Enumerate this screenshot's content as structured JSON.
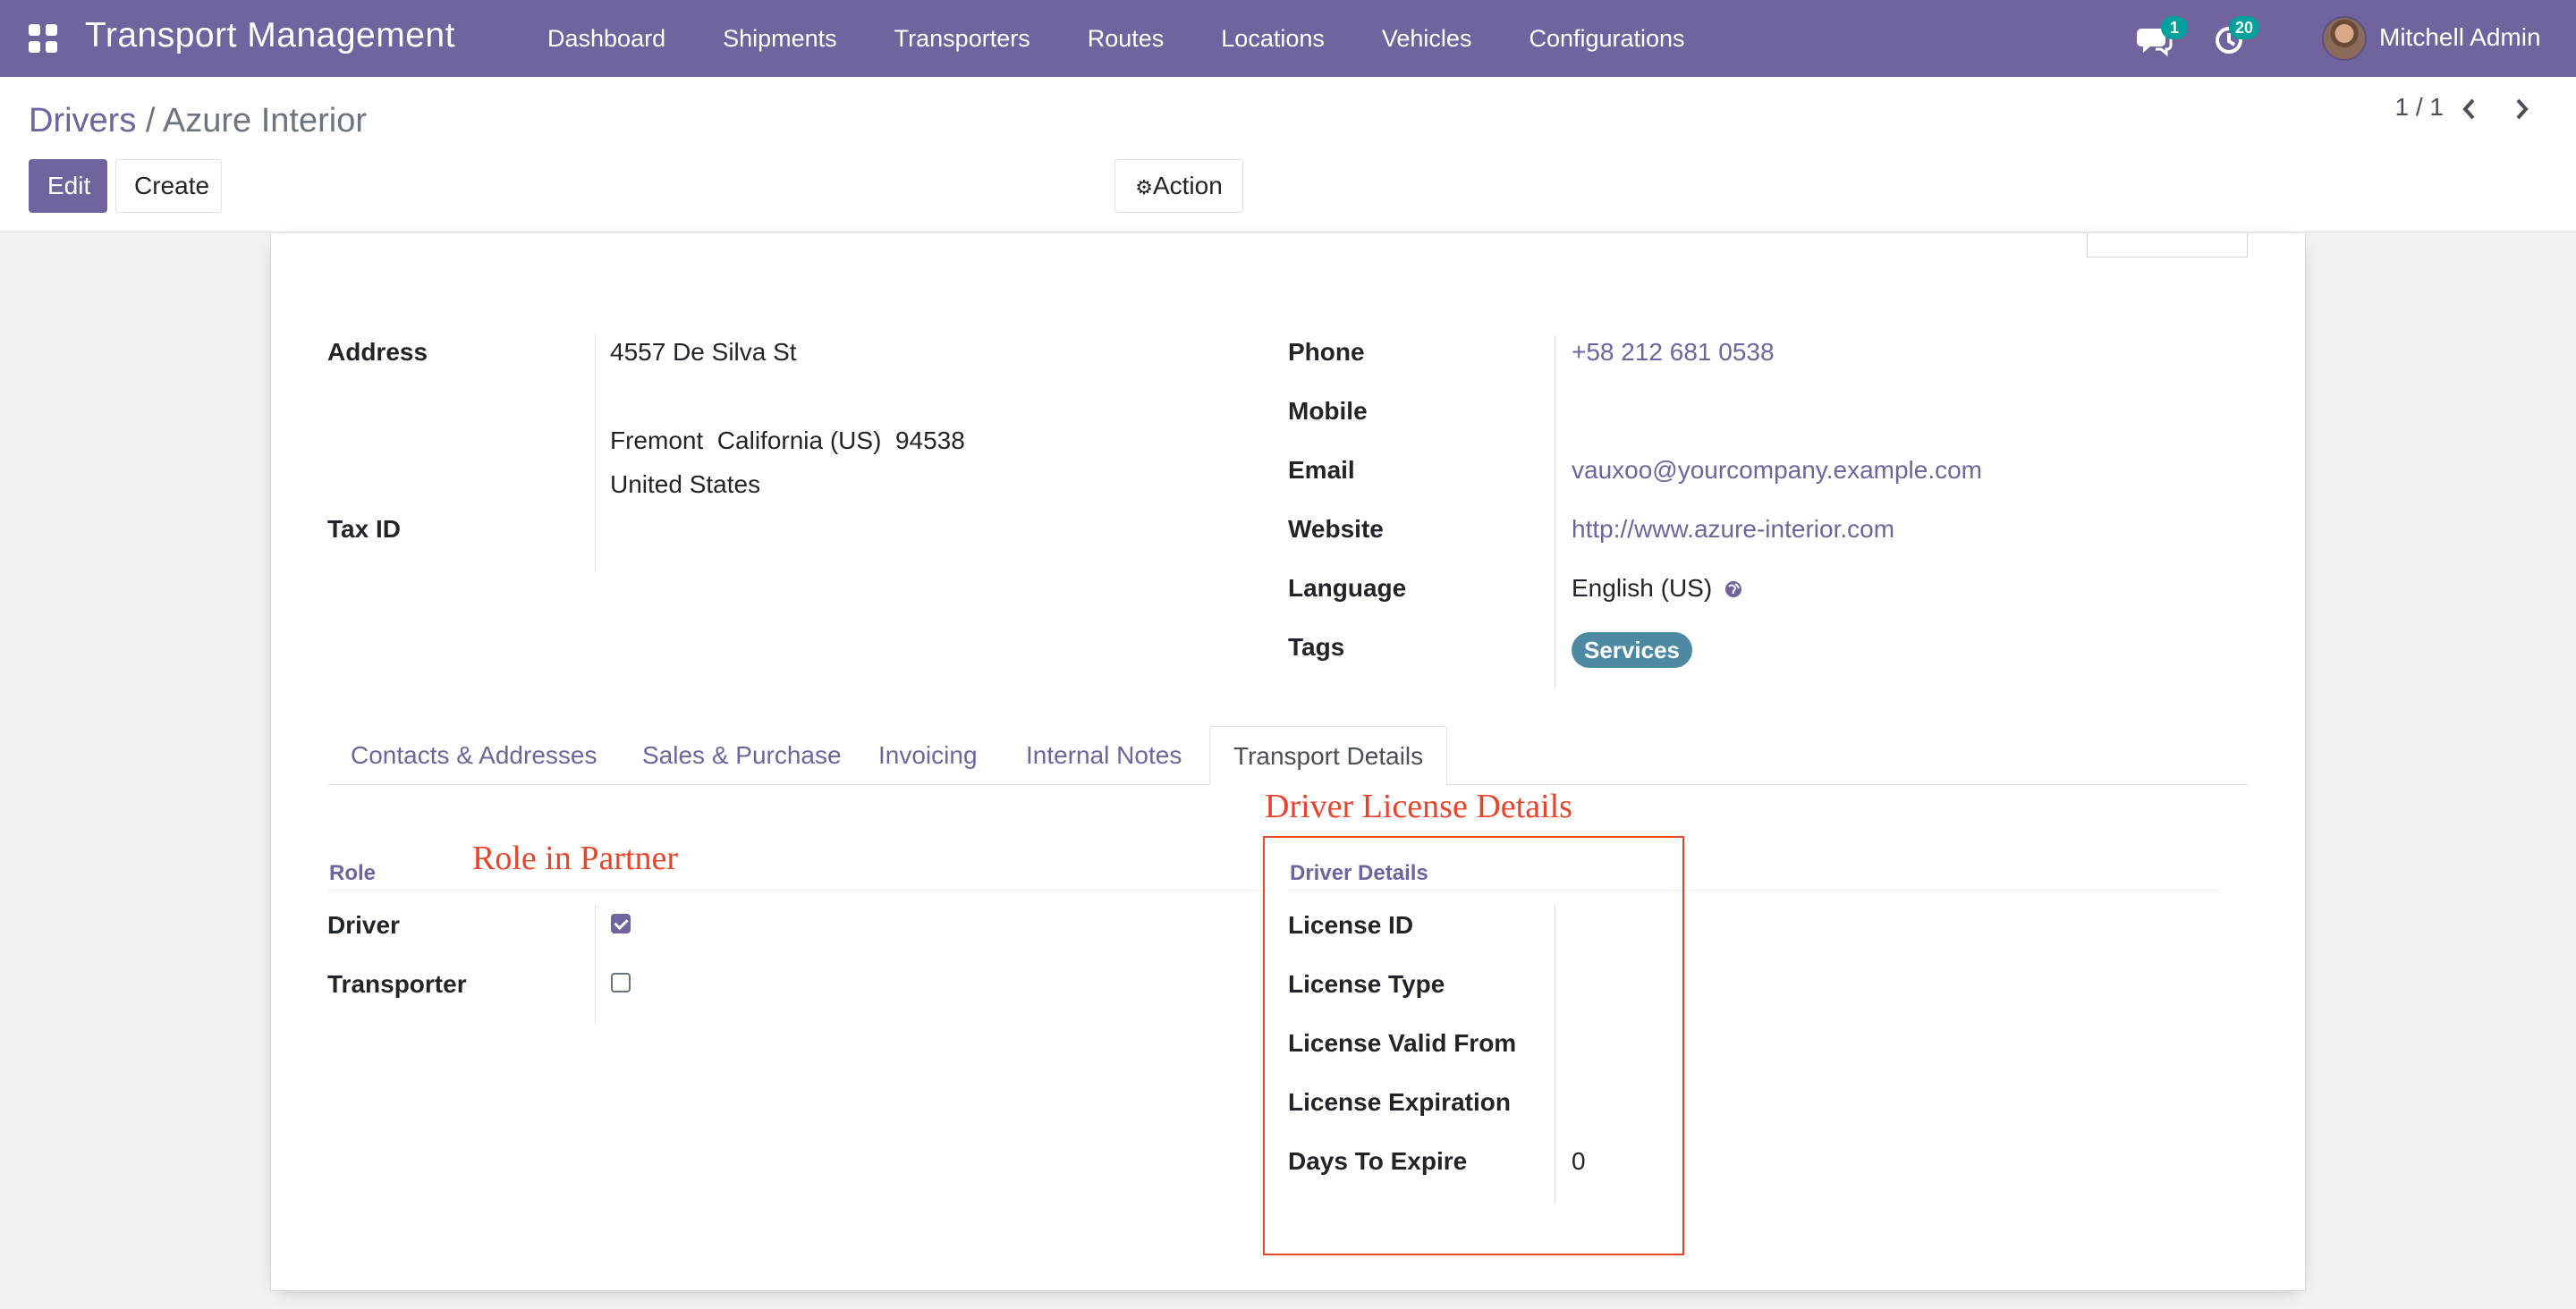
{
  "navbar": {
    "app_title": "Transport Management",
    "menu": [
      "Dashboard",
      "Shipments",
      "Transporters",
      "Routes",
      "Locations",
      "Vehicles",
      "Configurations"
    ],
    "messages_count": "1",
    "activities_count": "20",
    "user_name": "Mitchell Admin",
    "icons": [
      "apps-grid-icon",
      "chat-icon",
      "clock-icon",
      "user-avatar"
    ]
  },
  "control_panel": {
    "breadcrumb_parent": "Drivers",
    "breadcrumb_separator": " / ",
    "breadcrumb_current": "Azure Interior",
    "edit_label": "Edit",
    "create_label": "Create",
    "action_label": "Action",
    "pager": "1 / 1"
  },
  "form": {
    "address_label": "Address",
    "street": "4557 De Silva St",
    "city_line": "Fremont  California (US)  94538",
    "country": "United States",
    "tax_id_label": "Tax ID",
    "phone_label": "Phone",
    "phone": "+58 212 681 0538",
    "mobile_label": "Mobile",
    "email_label": "Email",
    "email": "vauxoo@yourcompany.example.com",
    "website_label": "Website",
    "website": "http://www.azure-interior.com",
    "language_label": "Language",
    "language": "English (US)",
    "tags_label": "Tags",
    "tag": "Services"
  },
  "tabs": [
    "Contacts & Addresses",
    "Sales & Purchase",
    "Invoicing",
    "Internal Notes",
    "Transport Details"
  ],
  "active_tab": "Transport Details",
  "transport": {
    "role_title": "Role",
    "driver_label": "Driver",
    "driver_checked": true,
    "transporter_label": "Transporter",
    "transporter_checked": false,
    "driver_details_title": "Driver Details",
    "license_id_label": "License ID",
    "license_type_label": "License Type",
    "license_valid_from_label": "License Valid From",
    "license_expiration_label": "License Expiration",
    "days_to_expire_label": "Days To Expire",
    "days_to_expire": "0"
  },
  "annotations": {
    "role_note": "Role in Partner",
    "license_note": "Driver License Details"
  },
  "colors": {
    "brand": "#71639e",
    "tag": "#4d8aa1",
    "badge": "#00a09d",
    "annotation": "#e8442a"
  }
}
